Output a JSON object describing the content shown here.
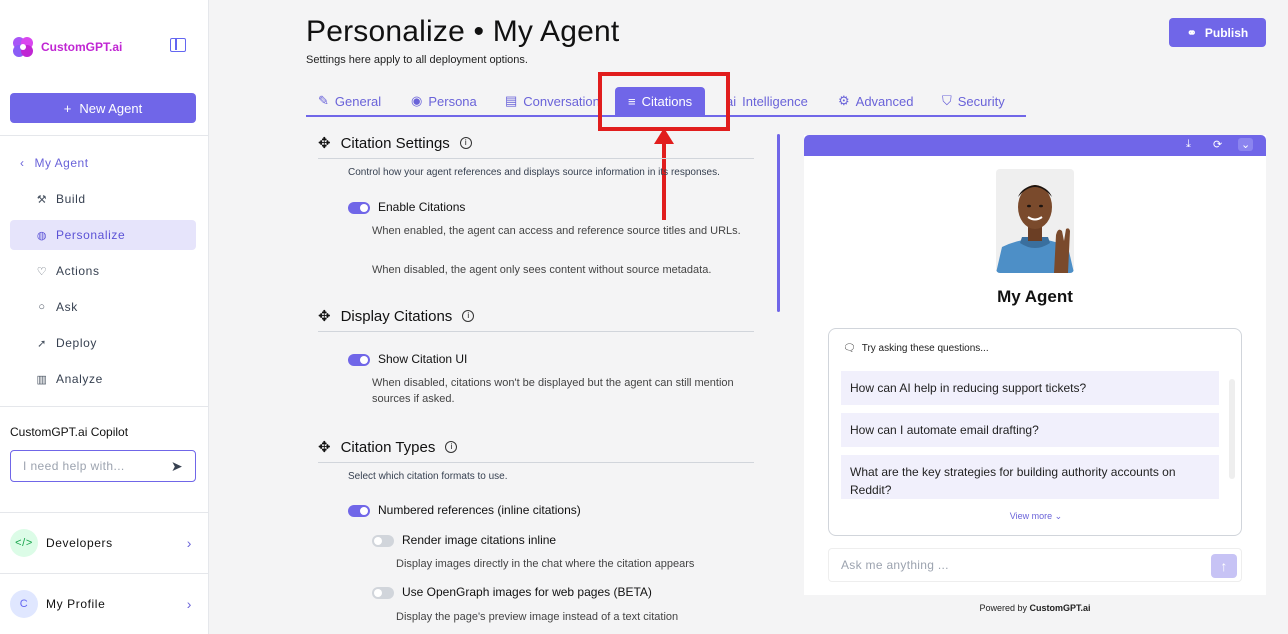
{
  "app": {
    "logo_text": "CustomGPT.ai",
    "new_agent_label": "New Agent"
  },
  "sidebar": {
    "back_label": "My Agent",
    "items": [
      {
        "label": "Build",
        "icon": "build-icon"
      },
      {
        "label": "Personalize",
        "icon": "palette-icon",
        "active": true
      },
      {
        "label": "Actions",
        "icon": "actions-icon"
      },
      {
        "label": "Ask",
        "icon": "chat-icon"
      },
      {
        "label": "Deploy",
        "icon": "rocket-icon"
      },
      {
        "label": "Analyze",
        "icon": "chart-icon"
      }
    ],
    "copilot_label": "CustomGPT.ai Copilot",
    "copilot_placeholder": "I need help with...",
    "developers_label": "Developers",
    "profile_label": "My Profile",
    "profile_initial": "C"
  },
  "header": {
    "title": "Personalize • My Agent",
    "subtitle": "Settings here apply to all deployment options.",
    "publish_label": "Publish"
  },
  "tabs": [
    {
      "label": "General",
      "icon": "general-icon"
    },
    {
      "label": "Persona",
      "icon": "persona-icon"
    },
    {
      "label": "Conversation",
      "icon": "conversation-icon"
    },
    {
      "label": "Citations",
      "icon": "citations-icon",
      "active": true
    },
    {
      "label": "Intelligence",
      "icon": "ai-icon"
    },
    {
      "label": "Advanced",
      "icon": "advanced-icon"
    },
    {
      "label": "Security",
      "icon": "shield-icon"
    }
  ],
  "citation_settings": {
    "title": "Citation Settings",
    "description": "Control how your agent references and displays source information in its responses.",
    "enable_label": "Enable Citations",
    "enable_desc_1": "When enabled, the agent can access and reference source titles and URLs.",
    "enable_desc_2": "When disabled, the agent only sees content without source metadata."
  },
  "display_citations": {
    "title": "Display Citations",
    "show_label": "Show Citation UI",
    "show_desc": "When disabled, citations won't be displayed but the agent can still mention sources if asked."
  },
  "citation_types": {
    "title": "Citation Types",
    "description": "Select which citation formats to use.",
    "numbered_label": "Numbered references (inline citations)",
    "render_label": "Render image citations inline",
    "render_desc": "Display images directly in the chat where the citation appears",
    "opengraph_label": "Use OpenGraph images for web pages (BETA)",
    "opengraph_desc": "Display the page's preview image instead of a text citation"
  },
  "preview": {
    "agent_name": "My Agent",
    "try_asking": "Try asking these questions...",
    "questions": [
      "How can AI help in reducing support tickets?",
      "How can I automate email drafting?",
      "What are the key strategies for building authority accounts on Reddit?"
    ],
    "view_more": "View more",
    "ask_placeholder": "Ask me anything ...",
    "powered_prefix": "Powered by",
    "powered_brand": "CustomGPT.ai"
  }
}
